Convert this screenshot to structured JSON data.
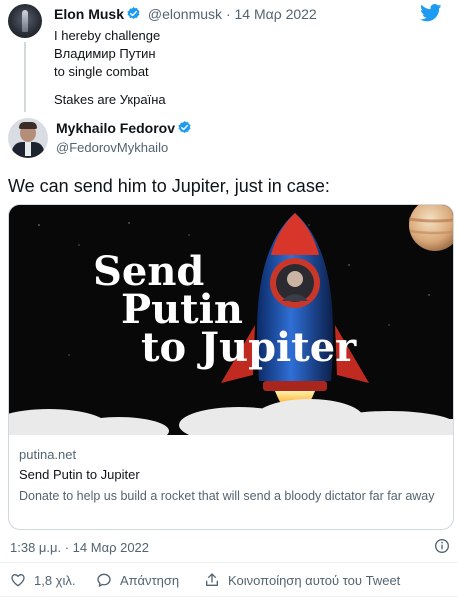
{
  "colors": {
    "accent": "#1d9bf0",
    "text": "#0f1419",
    "muted": "#536471",
    "border": "#cfd9de"
  },
  "quoted_tweet": {
    "name": "Elon Musk",
    "handle": "@elonmusk",
    "separator": "·",
    "date": "14 Μαρ 2022",
    "lines": [
      "I hereby challenge",
      "Владимир Путин",
      "to single combat",
      "",
      "Stakes are Україна"
    ]
  },
  "tweet": {
    "name": "Mykhailo Fedorov",
    "handle": "@FedorovMykhailo",
    "text": "We can send him to Jupiter, just in case:"
  },
  "card": {
    "image_text": [
      "Send",
      "Putin",
      "to Jupiter"
    ],
    "domain": "putina.net",
    "title": "Send Putin to Jupiter",
    "description": "Donate to help us build a rocket that will send a bloody dictator far far away"
  },
  "meta": {
    "timestamp": "1:38 μ.μ. · 14 Μαρ 2022"
  },
  "actions": {
    "likes": "1,8 χιλ.",
    "reply": "Απάντηση",
    "share": "Κοινοποίηση αυτού του Tweet"
  },
  "icons": [
    "twitter-bird-icon",
    "verified-icon",
    "info-icon",
    "heart-icon",
    "reply-icon",
    "share-icon"
  ]
}
